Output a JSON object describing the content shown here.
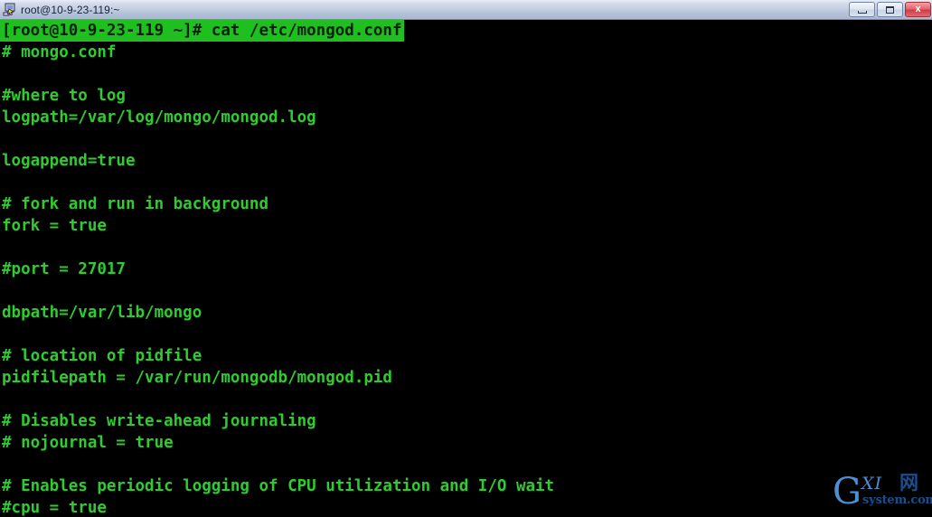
{
  "window": {
    "title": "root@10-9-23-119:~",
    "icon": "putty-terminal-icon",
    "controls": [
      {
        "name": "minimize-button",
        "glyph": "minimize"
      },
      {
        "name": "maximize-button",
        "glyph": "maximize"
      },
      {
        "name": "close-button",
        "glyph": "close",
        "label": "x"
      }
    ]
  },
  "terminal": {
    "colors": {
      "background": "#000000",
      "foreground": "#2fcc2f",
      "highlight_background": "#1fbf1f",
      "highlight_foreground": "#05210a"
    },
    "prompt": {
      "text": "[root@10-9-23-119 ~]# cat /etc/mongod.conf",
      "highlighted": true
    },
    "lines": [
      "# mongo.conf",
      "",
      "#where to log",
      "logpath=/var/log/mongo/mongod.log",
      "",
      "logappend=true",
      "",
      "# fork and run in background",
      "fork = true",
      "",
      "#port = 27017",
      "",
      "dbpath=/var/lib/mongo",
      "",
      "# location of pidfile",
      "pidfilepath = /var/run/mongodb/mongod.pid",
      "",
      "# Disables write-ahead journaling",
      "# nojournal = true",
      "",
      "# Enables periodic logging of CPU utilization and I/O wait",
      "#cpu = true"
    ]
  },
  "watermark": {
    "letter_g": "G",
    "letters_xi": "XI",
    "char_cn": "网",
    "domain": "system.com",
    "color": "#4b8fd4"
  }
}
